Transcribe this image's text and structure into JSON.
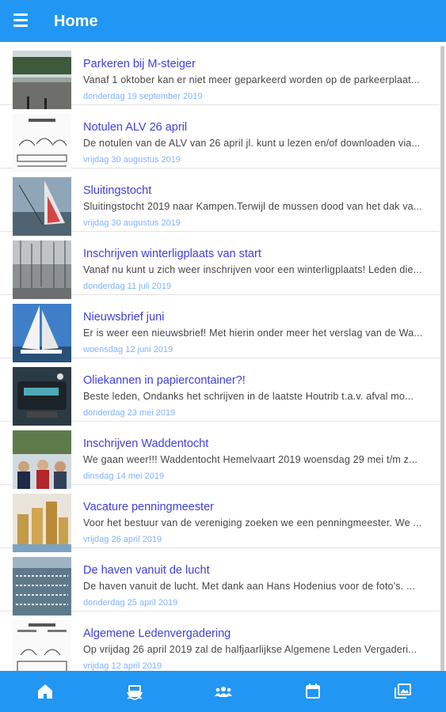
{
  "header": {
    "title": "Home"
  },
  "news": [
    {
      "title": "Parkeren bij M-steiger",
      "snippet": "Vanaf 1 oktober kan er niet meer geparkeerd worden op de parkeerplaat...",
      "date": "donderdag 19 september 2019"
    },
    {
      "title": "Notulen ALV 26 april",
      "snippet": "De notulen van de ALV van 26 april jl. kunt u lezen en/of downloaden via...",
      "date": "vrijdag 30 augustus 2019"
    },
    {
      "title": "Sluitingstocht",
      "snippet": "Sluitingstocht 2019 naar Kampen.Terwijl de mussen dood van het dak va...",
      "date": "vrijdag 30 augustus 2019"
    },
    {
      "title": "Inschrijven winterligplaats van start",
      "snippet": "Vanaf nu kunt u zich weer inschrijven voor een winterligplaats! Leden die...",
      "date": "donderdag 11 juli 2019"
    },
    {
      "title": "Nieuwsbrief juni",
      "snippet": "Er is weer een nieuwsbrief! Met hierin onder meer het verslag van de Wa...",
      "date": "woensdag 12 juni 2019"
    },
    {
      "title": "Oliekannen in papiercontainer?!",
      "snippet": "Beste leden,   Ondanks het schrijven in de laatste Houtrib t.a.v. afval mo...",
      "date": "donderdag 23 mei 2019"
    },
    {
      "title": "Inschrijven Waddentocht",
      "snippet": "We gaan weer!!!  Waddentocht Hemelvaart 2019 woensdag 29 mei t/m z...",
      "date": "dinsdag 14 mei 2019"
    },
    {
      "title": "Vacature penningmeester",
      "snippet": "Voor het bestuur van de vereniging zoeken we een penningmeester. We ...",
      "date": "vrijdag 26 april 2019"
    },
    {
      "title": "De haven vanuit de lucht",
      "snippet": "De haven vanuit de lucht. Met dank aan Hans Hodenius voor de foto's.   ...",
      "date": "donderdag 25 april 2019"
    },
    {
      "title": "Algemene Ledenvergadering",
      "snippet": "Op vrijdag 26 april 2019 zal de halfjaarlijkse Algemene Leden Vergaderi...",
      "date": "vrijdag 12 april 2019"
    }
  ],
  "bottom_nav": [
    "home-icon",
    "boat-icon",
    "members-icon",
    "calendar-icon",
    "gallery-icon"
  ],
  "colors": {
    "primary": "#2196f3",
    "title_link": "#3f3fd7",
    "date": "#7fb3ff"
  }
}
